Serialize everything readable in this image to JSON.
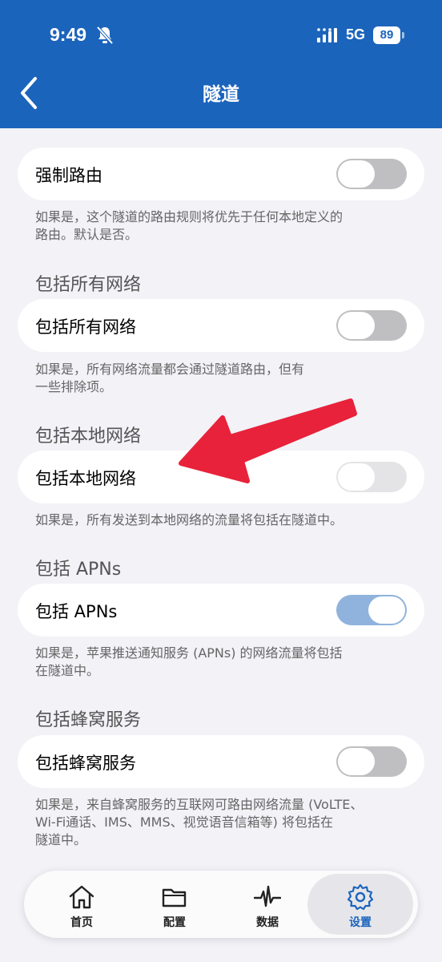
{
  "status_bar": {
    "time": "9:49",
    "network": "5G",
    "battery": "89"
  },
  "header": {
    "title": "隧道"
  },
  "settings": [
    {
      "section": "",
      "label": "强制路由",
      "toggle": "off",
      "description": "如果是，这个隧道的路由规则将优先于任何本地定义的\n路由。默认是否。"
    },
    {
      "section": "包括所有网络",
      "label": "包括所有网络",
      "toggle": "off",
      "description": "如果是，所有网络流量都会通过隧道路由，但有\n一些排除项。"
    },
    {
      "section": "包括本地网络",
      "label": "包括本地网络",
      "toggle": "off-disabled",
      "description": "如果是，所有发送到本地网络的流量将包括在隧道中。"
    },
    {
      "section": "包括 APNs",
      "label": "包括 APNs",
      "toggle": "on",
      "description": "如果是，苹果推送通知服务 (APNs) 的网络流量将包括\n在隧道中。"
    },
    {
      "section": "包括蜂窝服务",
      "label": "包括蜂窝服务",
      "toggle": "off",
      "description": "如果是，来自蜂窝服务的互联网可路由网络流量 (VoLTE、\nWi-Fi通话、IMS、MMS、视觉语音信箱等) 将包括在\n隧道中。"
    }
  ],
  "tabs": [
    {
      "label": "首页",
      "icon": "home-icon"
    },
    {
      "label": "配置",
      "icon": "folder-icon"
    },
    {
      "label": "数据",
      "icon": "activity-icon"
    },
    {
      "label": "设置",
      "icon": "gear-icon",
      "active": true
    }
  ],
  "colors": {
    "accent": "#1b64bc",
    "toggle_on": "#8fb3dc",
    "toggle_off": "#bfbfc2",
    "annotation_arrow": "#e8223a"
  },
  "annotation": {
    "arrow_icon": "red-arrow-icon",
    "points_to": "包括本地网络"
  }
}
